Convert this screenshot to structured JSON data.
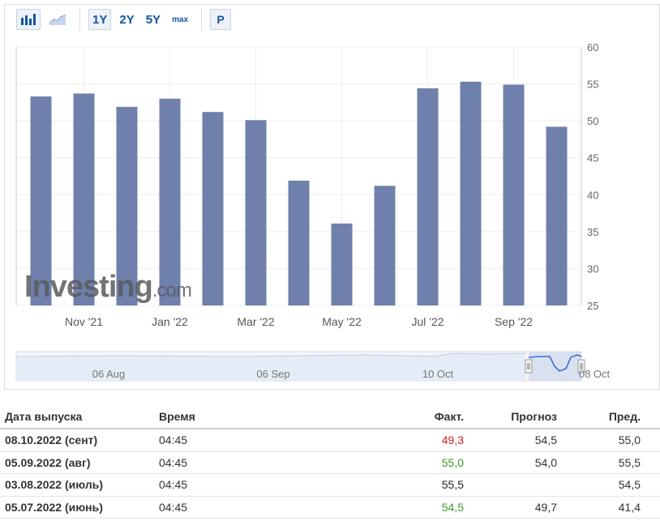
{
  "toolbar": {
    "bar_icon": "bar-chart-icon",
    "line_icon": "line-chart-icon",
    "ranges": [
      "1Y",
      "2Y",
      "5Y",
      "max"
    ],
    "active_range": "1Y",
    "p_button": "P"
  },
  "watermark": {
    "brand": "Investing",
    "suffix": ".com"
  },
  "colors": {
    "bar": "#6e80ab",
    "bar_light": "#b4bed7",
    "nav_line": "#3b6fd4"
  },
  "chart_data": {
    "type": "bar",
    "categories": [
      "",
      "Nov '21",
      "",
      "Jan '22",
      "",
      "Mar '22",
      "",
      "May '22",
      "",
      "Jul '22",
      "",
      "Sep '22",
      ""
    ],
    "values": [
      53.3,
      53.7,
      51.9,
      53.0,
      51.2,
      50.1,
      41.9,
      36.1,
      41.2,
      54.4,
      55.3,
      54.9,
      49.2
    ],
    "x_tick_labels": [
      "Nov '21",
      "Jan '22",
      "Mar '22",
      "May '22",
      "Jul '22",
      "Sep '22"
    ],
    "y_ticks": [
      25,
      30,
      35,
      40,
      45,
      50,
      55,
      60
    ],
    "ylim": [
      25,
      60
    ],
    "y_axis_side": "right",
    "grid": true,
    "title": "",
    "xlabel": "",
    "ylabel": ""
  },
  "navigator": {
    "labels": [
      "06 Aug",
      "06 Sep",
      "10 Oct",
      "08 Oct"
    ]
  },
  "table": {
    "headers": {
      "date": "Дата выпуска",
      "time": "Время",
      "actual": "Факт.",
      "forecast": "Прогноз",
      "previous": "Пред."
    },
    "rows": [
      {
        "date": "08.10.2022 (сент)",
        "time": "04:45",
        "actual": "49,3",
        "actual_state": "neg",
        "forecast": "54,5",
        "previous": "55,0"
      },
      {
        "date": "05.09.2022 (авг)",
        "time": "04:45",
        "actual": "55,0",
        "actual_state": "pos",
        "forecast": "54,0",
        "previous": "55,5"
      },
      {
        "date": "03.08.2022 (июль)",
        "time": "04:45",
        "actual": "55,5",
        "actual_state": "neu",
        "forecast": "",
        "previous": "54,5"
      },
      {
        "date": "05.07.2022 (июнь)",
        "time": "04:45",
        "actual": "54,5",
        "actual_state": "pos",
        "forecast": "49,7",
        "previous": "41,4"
      }
    ]
  }
}
